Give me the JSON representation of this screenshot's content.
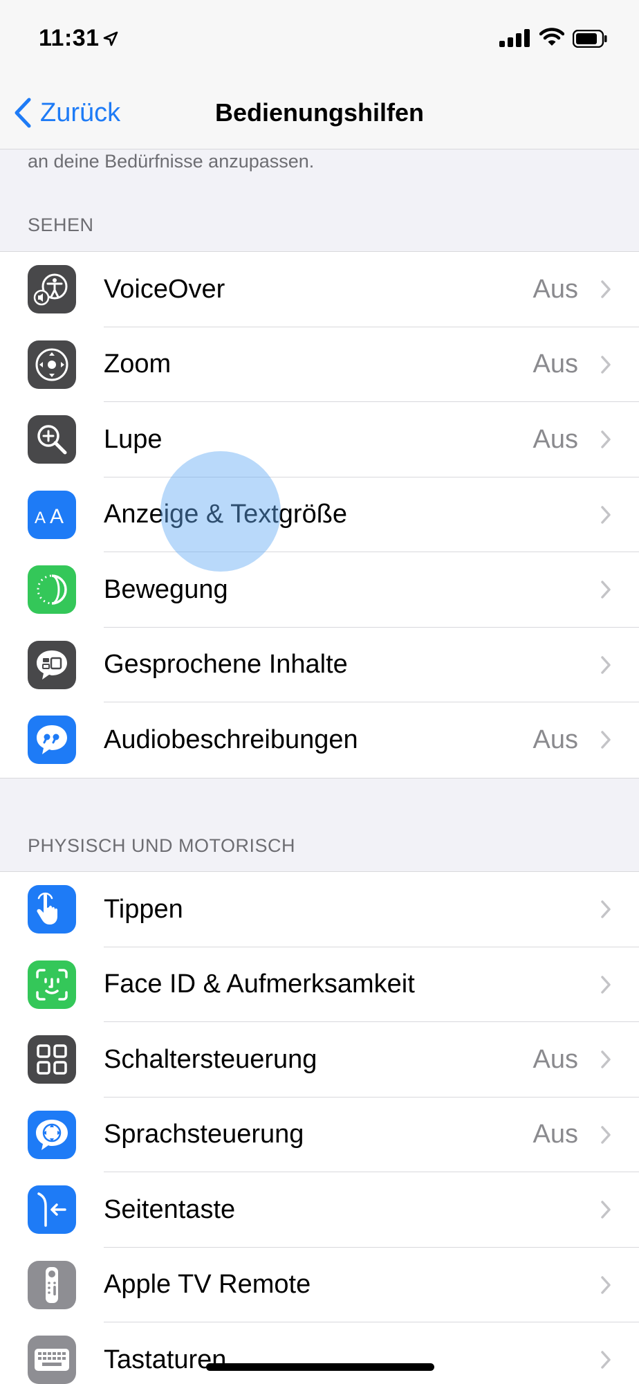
{
  "status_bar": {
    "time": "11:31"
  },
  "nav": {
    "back_label": "Zurück",
    "title": "Bedienungshilfen"
  },
  "intro_text": "an deine Bedürfnisse anzupassen.",
  "sections": [
    {
      "header": "SEHEN",
      "items": [
        {
          "label": "VoiceOver",
          "value": "Aus",
          "icon": "voiceover-icon",
          "color": "#48484a"
        },
        {
          "label": "Zoom",
          "value": "Aus",
          "icon": "zoom-icon",
          "color": "#48484a"
        },
        {
          "label": "Lupe",
          "value": "Aus",
          "icon": "magnifier-icon",
          "color": "#48484a"
        },
        {
          "label": "Anzeige & Textgröße",
          "value": "",
          "icon": "text-size-icon",
          "color": "#1e7bf6"
        },
        {
          "label": "Bewegung",
          "value": "",
          "icon": "motion-icon",
          "color": "#34c759"
        },
        {
          "label": "Gesprochene Inhalte",
          "value": "",
          "icon": "spoken-content-icon",
          "color": "#48484a"
        },
        {
          "label": "Audiobeschreibungen",
          "value": "Aus",
          "icon": "audio-description-icon",
          "color": "#1e7bf6"
        }
      ]
    },
    {
      "header": "PHYSISCH UND MOTORISCH",
      "items": [
        {
          "label": "Tippen",
          "value": "",
          "icon": "touch-icon",
          "color": "#1e7bf6"
        },
        {
          "label": "Face ID & Aufmerksamkeit",
          "value": "",
          "icon": "face-id-icon",
          "color": "#34c759"
        },
        {
          "label": "Schaltersteuerung",
          "value": "Aus",
          "icon": "switch-control-icon",
          "color": "#48484a"
        },
        {
          "label": "Sprachsteuerung",
          "value": "Aus",
          "icon": "voice-control-icon",
          "color": "#1e7bf6"
        },
        {
          "label": "Seitentaste",
          "value": "",
          "icon": "side-button-icon",
          "color": "#1e7bf6"
        },
        {
          "label": "Apple TV Remote",
          "value": "",
          "icon": "tv-remote-icon",
          "color": "#8e8e93"
        },
        {
          "label": "Tastaturen",
          "value": "",
          "icon": "keyboard-icon",
          "color": "#8e8e93"
        }
      ]
    }
  ]
}
